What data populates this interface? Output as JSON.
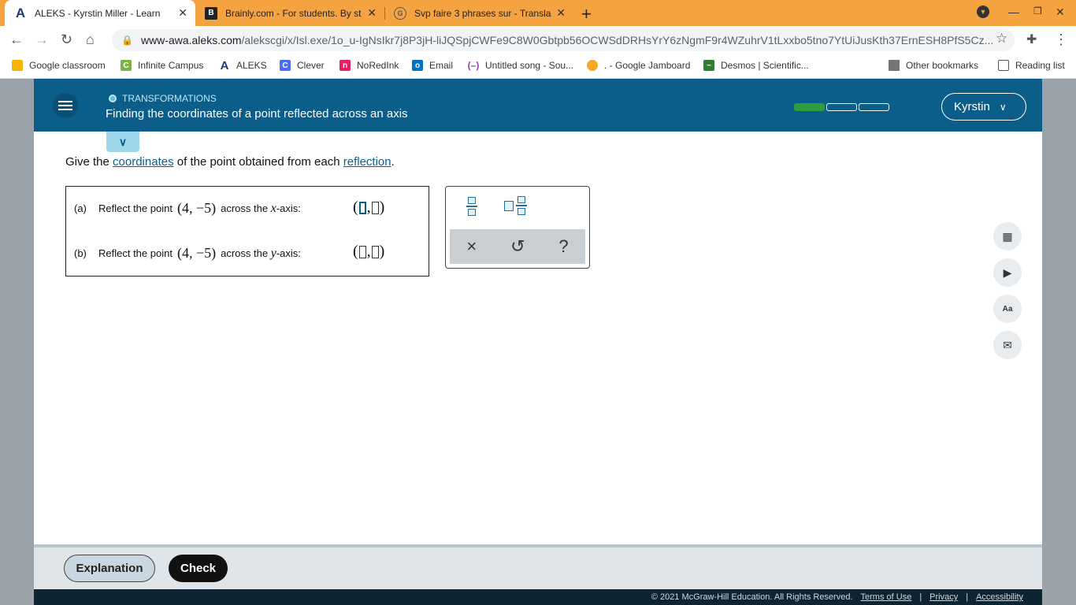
{
  "browser": {
    "tabs": [
      {
        "title": "ALEKS - Kyrstin Miller - Learn",
        "icon": "aleks-icon"
      },
      {
        "title": "Brainly.com - For students. By st",
        "icon": "brainly-icon"
      },
      {
        "title": "Svp faire 3 phrases sur - Transla",
        "icon": "translate-icon"
      }
    ],
    "url_domain": "www-awa.aleks.com",
    "url_rest": "/alekscgi/x/Isl.exe/1o_u-IgNsIkr7j8P3jH-liJQSpjCWFe9C8W0Gbtpb56OCWSdDRHsYrY6zNgmF9r4WZuhrV1tLxxbo5tno7YtUiJusKth37ErnESH8PfS5Cz...",
    "bookmarks": [
      {
        "label": "Google classroom",
        "color": "#f4b400"
      },
      {
        "label": "Infinite Campus",
        "color": "#7cb342"
      },
      {
        "label": "ALEKS",
        "color": "#1c3d6e"
      },
      {
        "label": "Clever",
        "color": "#4a6cf7"
      },
      {
        "label": "NoRedInk",
        "color": "#e91e63"
      },
      {
        "label": "Email",
        "color": "#0072c6"
      },
      {
        "label": "Untitled song - Sou...",
        "color": "#8e44ad"
      },
      {
        "label": ". - Google Jamboard",
        "color": "#f9a825"
      },
      {
        "label": "Desmos | Scientific...",
        "color": "#2e7d32"
      }
    ],
    "other_bookmarks": "Other bookmarks",
    "reading_list": "Reading list"
  },
  "header": {
    "topic": "TRANSFORMATIONS",
    "title": "Finding the coordinates of a point reflected across an axis",
    "progress_filled": 1,
    "progress_total": 3,
    "user": "Kyrstin"
  },
  "prompt": {
    "before": "Give the ",
    "link1": "coordinates",
    "middle": " of the point obtained from each ",
    "link2": "reflection",
    "after": "."
  },
  "questions": [
    {
      "label": "(a)",
      "text": "Reflect the point",
      "point": "(4,  −5)",
      "across": "across the",
      "axis_var": "x",
      "axis_suffix": "-axis:"
    },
    {
      "label": "(b)",
      "text": "Reflect the point",
      "point": "(4,  −5)",
      "across": "across the",
      "axis_var": "y",
      "axis_suffix": "-axis:"
    }
  ],
  "keypad": {
    "clear": "×",
    "undo": "↺",
    "help": "?"
  },
  "footer": {
    "explanation": "Explanation",
    "check": "Check",
    "copyright": "© 2021 McGraw-Hill Education. All Rights Reserved.",
    "terms": "Terms of Use",
    "privacy": "Privacy",
    "accessibility": "Accessibility",
    "sep": "|"
  }
}
